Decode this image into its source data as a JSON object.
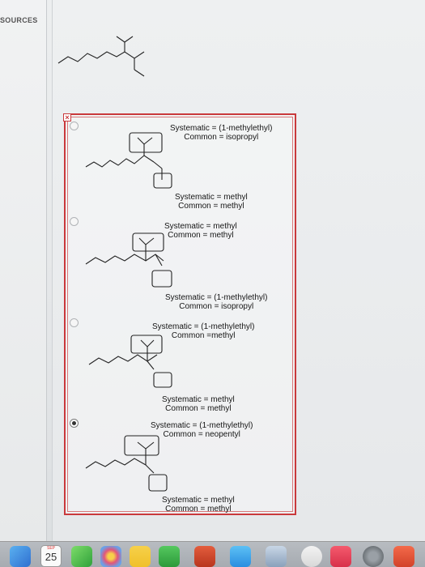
{
  "sidebar": {
    "sources_label": "SOURCES"
  },
  "answer_box": {
    "close_glyph": "×"
  },
  "options": [
    {
      "selected": false,
      "top_label": {
        "systematic": "Systematic = (1-methylethyl)",
        "common": "Common = isopropyl"
      },
      "bottom_label": {
        "systematic": "Systematic = methyl",
        "common": "Common = methyl"
      }
    },
    {
      "selected": false,
      "top_label": {
        "systematic": "Systematic = methyl",
        "common": "Common = methyl"
      },
      "bottom_label": {
        "systematic": "Systematic = (1-methylethyl)",
        "common": "Common = isopropyl"
      }
    },
    {
      "selected": false,
      "top_label": {
        "systematic": "Systematic = (1-methylethyl)",
        "common": "Common =methyl"
      },
      "bottom_label": {
        "systematic": "Systematic = methyl",
        "common": "Common = methyl"
      }
    },
    {
      "selected": true,
      "top_label": {
        "systematic": "Systematic = (1-methylethyl)",
        "common": "Common = neopentyl"
      },
      "bottom_label": {
        "systematic": "Systematic = methyl",
        "common": "Common = methyl"
      }
    }
  ],
  "dock": {
    "calendar_day": "25",
    "calendar_month": "SEP"
  },
  "colors": {
    "box_border": "#c9393c",
    "accent": "#c9393c"
  }
}
